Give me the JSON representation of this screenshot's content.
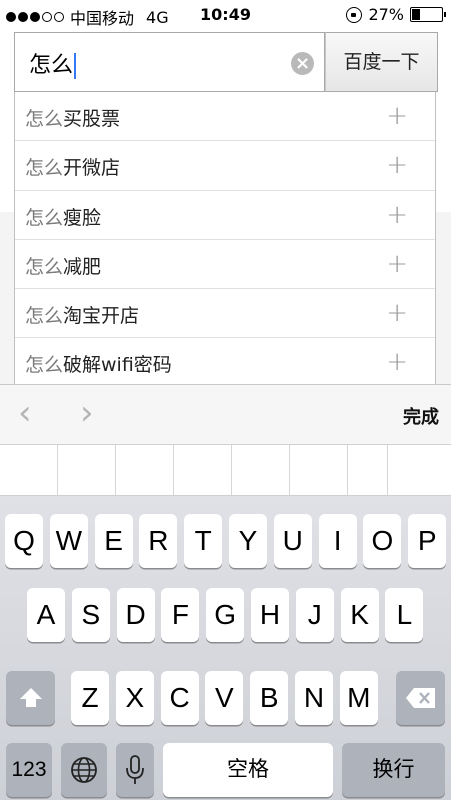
{
  "status_bar": {
    "signal_dots": 5,
    "signal_filled": 3,
    "carrier": "中国移动",
    "network": "4G",
    "time": "10:49",
    "battery_percent": "27%",
    "battery_level": 0.27
  },
  "search": {
    "query": "怎么",
    "clear_icon": "clear-icon",
    "submit_label": "百度一下"
  },
  "suggestions": [
    {
      "prefix": "怎么",
      "rest": "买股票",
      "add_icon": "+"
    },
    {
      "prefix": "怎么",
      "rest": "开微店",
      "add_icon": "+"
    },
    {
      "prefix": "怎么",
      "rest": "瘦脸",
      "add_icon": "+"
    },
    {
      "prefix": "怎么",
      "rest": "减肥",
      "add_icon": "+"
    },
    {
      "prefix": "怎么",
      "rest": "淘宝开店",
      "add_icon": "+"
    },
    {
      "prefix": "怎么",
      "rest": "破解wifi密码",
      "add_icon": "+"
    }
  ],
  "accessory": {
    "prev_icon": "‹",
    "next_icon": "›",
    "done_label": "完成"
  },
  "keyboard": {
    "row1": [
      "Q",
      "W",
      "E",
      "R",
      "T",
      "Y",
      "U",
      "I",
      "O",
      "P"
    ],
    "row2": [
      "A",
      "S",
      "D",
      "F",
      "G",
      "H",
      "J",
      "K",
      "L"
    ],
    "row3": [
      "Z",
      "X",
      "C",
      "V",
      "B",
      "N",
      "M"
    ],
    "numbers_label": "123",
    "space_label": "空格",
    "return_label": "换行"
  },
  "colors": {
    "keyboard_bg": "#d1d4da",
    "dark_key": "#adb2bb",
    "caret": "#3478f6"
  }
}
